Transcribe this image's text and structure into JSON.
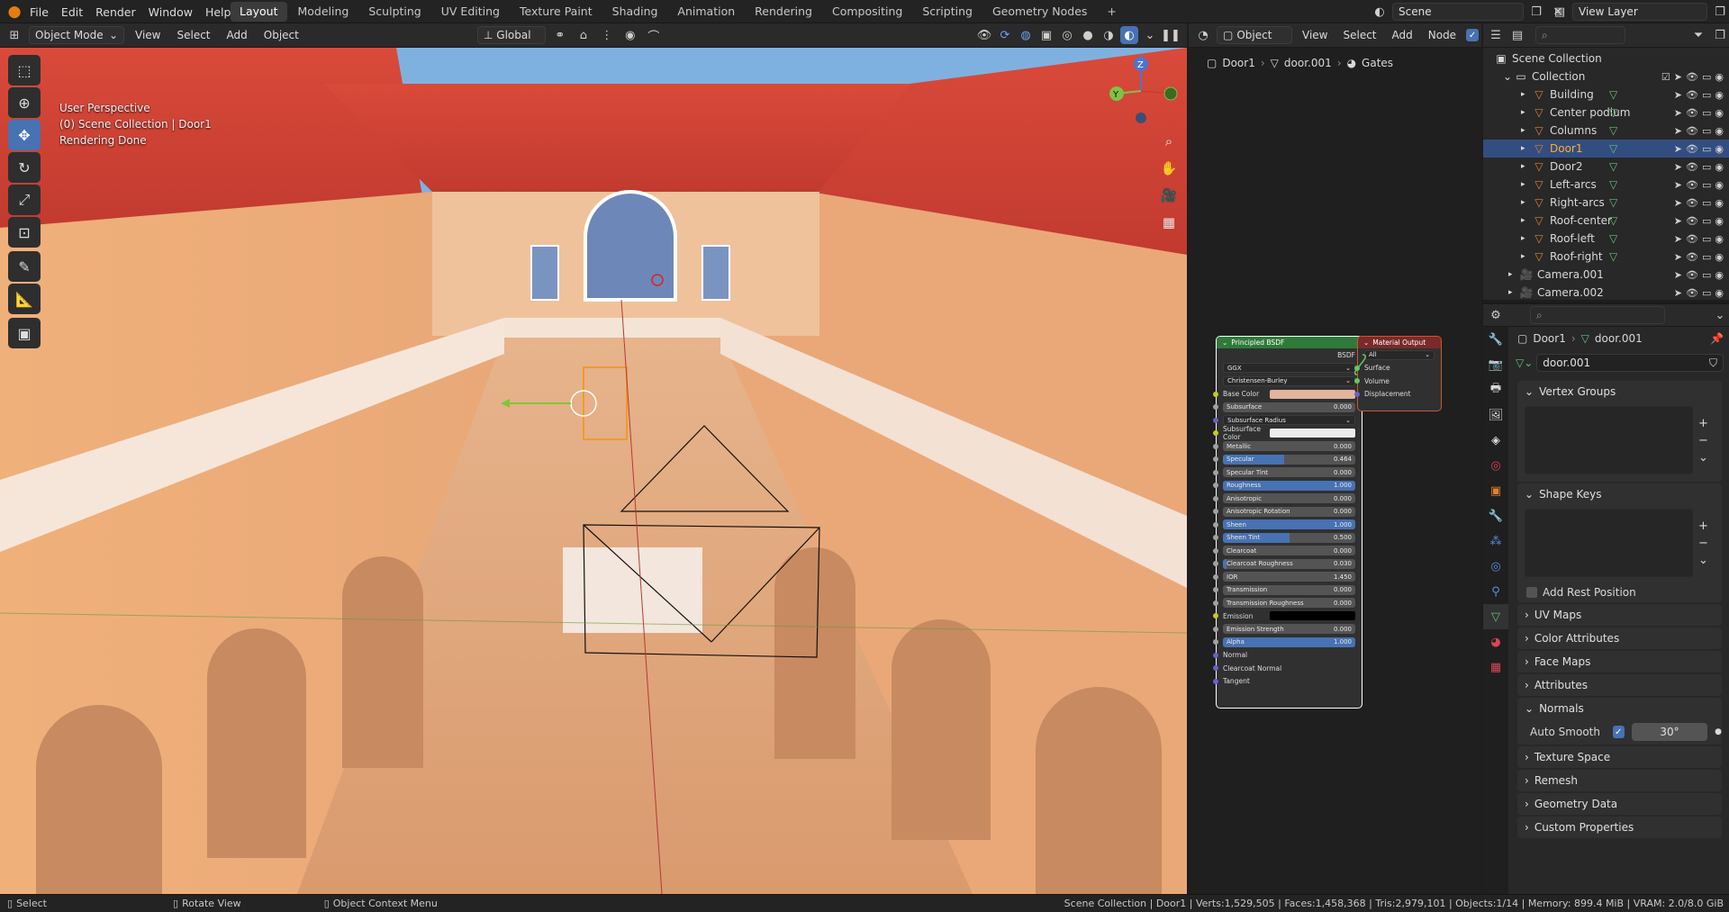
{
  "topbar": {
    "menus": [
      "File",
      "Edit",
      "Render",
      "Window",
      "Help"
    ],
    "workspaces": [
      "Layout",
      "Modeling",
      "Sculpting",
      "UV Editing",
      "Texture Paint",
      "Shading",
      "Animation",
      "Rendering",
      "Compositing",
      "Scripting",
      "Geometry Nodes"
    ],
    "active_workspace": "Layout",
    "scene": "Scene",
    "view_layer": "View Layer"
  },
  "viewport_header": {
    "mode": "Object Mode",
    "menus": [
      "View",
      "Select",
      "Add",
      "Object"
    ],
    "transform_orientation": "Global"
  },
  "viewport": {
    "overlay_lines": [
      "User Perspective",
      "(0) Scene Collection | Door1",
      "Rendering Done"
    ],
    "gizmo_axes": {
      "z": "Z",
      "y": "Y"
    }
  },
  "node_header": {
    "mode": "Object",
    "menus": [
      "View",
      "Select",
      "Add",
      "Node"
    ],
    "breadcrumb": [
      "Door1",
      "door.001",
      "Gates"
    ]
  },
  "bsdf_node": {
    "title": "Principled BSDF",
    "output": "BSDF",
    "distribution": "GGX",
    "subsurface_method": "Christensen-Burley",
    "rows": [
      {
        "label": "Base Color",
        "type": "color",
        "color": "#e2b39e"
      },
      {
        "label": "Subsurface",
        "value": "0.000",
        "fill": 0
      },
      {
        "label": "Subsurface Radius",
        "type": "dropdown"
      },
      {
        "label": "Subsurface Color",
        "type": "color",
        "color": "#ededed"
      },
      {
        "label": "Metallic",
        "value": "0.000",
        "fill": 0
      },
      {
        "label": "Specular",
        "value": "0.464",
        "fill": 0.464
      },
      {
        "label": "Specular Tint",
        "value": "0.000",
        "fill": 0
      },
      {
        "label": "Roughness",
        "value": "1.000",
        "fill": 1
      },
      {
        "label": "Anisotropic",
        "value": "0.000",
        "fill": 0
      },
      {
        "label": "Anisotropic Rotation",
        "value": "0.000",
        "fill": 0
      },
      {
        "label": "Sheen",
        "value": "1.000",
        "fill": 1
      },
      {
        "label": "Sheen Tint",
        "value": "0.500",
        "fill": 0.5
      },
      {
        "label": "Clearcoat",
        "value": "0.000",
        "fill": 0
      },
      {
        "label": "Clearcoat Roughness",
        "value": "0.030",
        "fill": 0.03
      },
      {
        "label": "IOR",
        "value": "1.450",
        "fill": 0
      },
      {
        "label": "Transmission",
        "value": "0.000",
        "fill": 0
      },
      {
        "label": "Transmission Roughness",
        "value": "0.000",
        "fill": 0
      },
      {
        "label": "Emission",
        "type": "color",
        "color": "#000000"
      },
      {
        "label": "Emission Strength",
        "value": "0.000",
        "fill": 0
      },
      {
        "label": "Alpha",
        "value": "1.000",
        "fill": 1
      },
      {
        "label": "Normal",
        "type": "socket"
      },
      {
        "label": "Clearcoat Normal",
        "type": "socket"
      },
      {
        "label": "Tangent",
        "type": "socket"
      }
    ]
  },
  "output_node": {
    "title": "Material Output",
    "target": "All",
    "inputs": [
      "Surface",
      "Volume",
      "Displacement"
    ]
  },
  "outliner": {
    "root": "Scene Collection",
    "collection": "Collection",
    "items": [
      {
        "name": "Building",
        "selected": false
      },
      {
        "name": "Center podium",
        "selected": false
      },
      {
        "name": "Columns",
        "selected": false
      },
      {
        "name": "Door1",
        "selected": true
      },
      {
        "name": "Door2",
        "selected": false
      },
      {
        "name": "Left-arcs",
        "selected": false
      },
      {
        "name": "Right-arcs",
        "selected": false
      },
      {
        "name": "Roof-center",
        "selected": false
      },
      {
        "name": "Roof-left",
        "selected": false
      },
      {
        "name": "Roof-right",
        "selected": false
      }
    ],
    "cameras": [
      "Camera.001",
      "Camera.002"
    ]
  },
  "properties": {
    "breadcrumb": [
      "Door1",
      "door.001"
    ],
    "datablock": "door.001",
    "panels_top": [
      "Vertex Groups",
      "Shape Keys"
    ],
    "add_rest_position": "Add Rest Position",
    "panels": [
      "UV Maps",
      "Color Attributes",
      "Face Maps",
      "Attributes"
    ],
    "normals": {
      "title": "Normals",
      "auto_smooth_label": "Auto Smooth",
      "auto_smooth_angle": "30°"
    },
    "panels_bottom": [
      "Texture Space",
      "Remesh",
      "Geometry Data",
      "Custom Properties"
    ]
  },
  "statusbar": {
    "left": [
      {
        "key": "select",
        "label": "Select"
      },
      {
        "key": "rotate",
        "label": "Rotate View"
      },
      {
        "key": "context",
        "label": "Object Context Menu"
      }
    ],
    "right": "Scene Collection | Door1 | Verts:1,529,505 | Faces:1,458,368 | Tris:2,979,101 | Objects:1/14 | Memory: 899.4 MiB | VRAM: 2.0/8.0 GiB"
  },
  "colors": {
    "accent": "#4772b3",
    "selection": "#334d80",
    "bsdf_header": "#2f7a3a",
    "output_header": "#7a2a2a",
    "object_orange": "#e0822f",
    "mesh_green": "#62c27a"
  }
}
